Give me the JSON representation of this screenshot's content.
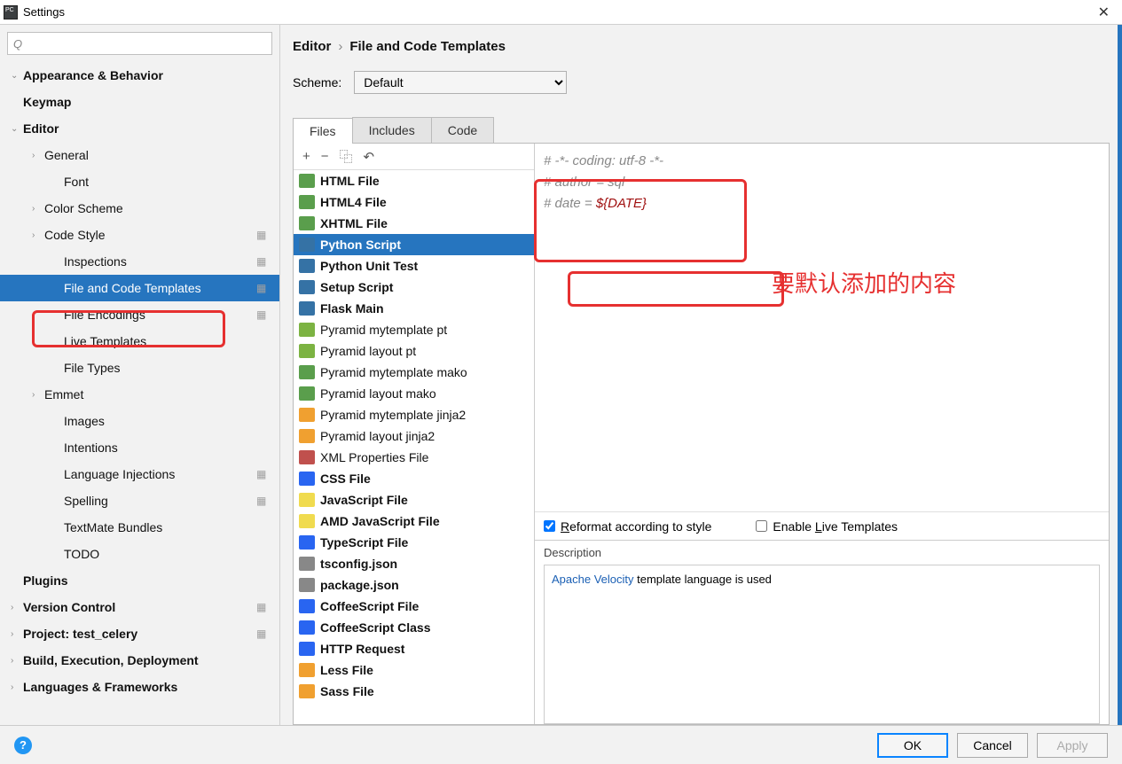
{
  "window": {
    "title": "Settings"
  },
  "search": {
    "placeholder": ""
  },
  "sidebar": {
    "items": [
      {
        "label": "Appearance & Behavior",
        "lvl": 0,
        "bold": true,
        "chev": "v"
      },
      {
        "label": "Keymap",
        "lvl": 0,
        "bold": true
      },
      {
        "label": "Editor",
        "lvl": 0,
        "bold": true,
        "chev": "v"
      },
      {
        "label": "General",
        "lvl": 1,
        "chev": ">"
      },
      {
        "label": "Font",
        "lvl": 2
      },
      {
        "label": "Color Scheme",
        "lvl": 1,
        "chev": ">"
      },
      {
        "label": "Code Style",
        "lvl": 1,
        "chev": ">",
        "gear": true
      },
      {
        "label": "Inspections",
        "lvl": 2,
        "gear": true
      },
      {
        "label": "File and Code Templates",
        "lvl": 2,
        "gear": true,
        "selected": true
      },
      {
        "label": "File Encodings",
        "lvl": 2,
        "gear": true
      },
      {
        "label": "Live Templates",
        "lvl": 2
      },
      {
        "label": "File Types",
        "lvl": 2
      },
      {
        "label": "Emmet",
        "lvl": 1,
        "chev": ">"
      },
      {
        "label": "Images",
        "lvl": 2
      },
      {
        "label": "Intentions",
        "lvl": 2
      },
      {
        "label": "Language Injections",
        "lvl": 2,
        "gear": true
      },
      {
        "label": "Spelling",
        "lvl": 2,
        "gear": true
      },
      {
        "label": "TextMate Bundles",
        "lvl": 2
      },
      {
        "label": "TODO",
        "lvl": 2
      },
      {
        "label": "Plugins",
        "lvl": 0,
        "bold": true
      },
      {
        "label": "Version Control",
        "lvl": 0,
        "bold": true,
        "chev": ">",
        "gear": true
      },
      {
        "label": "Project: test_celery",
        "lvl": 0,
        "bold": true,
        "chev": ">",
        "gear": true
      },
      {
        "label": "Build, Execution, Deployment",
        "lvl": 0,
        "bold": true,
        "chev": ">"
      },
      {
        "label": "Languages & Frameworks",
        "lvl": 0,
        "bold": true,
        "chev": ">"
      }
    ]
  },
  "breadcrumb": {
    "parent": "Editor",
    "current": "File and Code Templates"
  },
  "scheme": {
    "label": "Scheme:",
    "value": "Default"
  },
  "tabs": [
    "Files",
    "Includes",
    "Code"
  ],
  "active_tab": "Files",
  "toolbar": {
    "add": "+",
    "remove": "−",
    "copy": "⿻",
    "undo": "↶"
  },
  "templates": [
    {
      "label": "HTML File",
      "color": "#5a9e4c"
    },
    {
      "label": "HTML4 File",
      "color": "#5a9e4c"
    },
    {
      "label": "XHTML File",
      "color": "#5a9e4c"
    },
    {
      "label": "Python Script",
      "color": "#3572A5",
      "selected": true
    },
    {
      "label": "Python Unit Test",
      "color": "#3572A5"
    },
    {
      "label": "Setup Script",
      "color": "#3572A5"
    },
    {
      "label": "Flask Main",
      "color": "#3572A5"
    },
    {
      "label": "Pyramid mytemplate pt",
      "color": "#7cb342",
      "plain": true
    },
    {
      "label": "Pyramid layout pt",
      "color": "#7cb342",
      "plain": true
    },
    {
      "label": "Pyramid mytemplate mako",
      "color": "#5a9e4c",
      "plain": true
    },
    {
      "label": "Pyramid layout mako",
      "color": "#5a9e4c",
      "plain": true
    },
    {
      "label": "Pyramid mytemplate jinja2",
      "color": "#f0a030",
      "plain": true
    },
    {
      "label": "Pyramid layout jinja2",
      "color": "#f0a030",
      "plain": true
    },
    {
      "label": "XML Properties File",
      "color": "#c0504d",
      "plain": true
    },
    {
      "label": "CSS File",
      "color": "#2965f1"
    },
    {
      "label": "JavaScript File",
      "color": "#f0db4f"
    },
    {
      "label": "AMD JavaScript File",
      "color": "#f0db4f"
    },
    {
      "label": "TypeScript File",
      "color": "#2965f1"
    },
    {
      "label": "tsconfig.json",
      "color": "#888"
    },
    {
      "label": "package.json",
      "color": "#888"
    },
    {
      "label": "CoffeeScript File",
      "color": "#2965f1"
    },
    {
      "label": "CoffeeScript Class",
      "color": "#2965f1"
    },
    {
      "label": "HTTP Request",
      "color": "#2965f1"
    },
    {
      "label": "Less File",
      "color": "#f0a030"
    },
    {
      "label": "Sass File",
      "color": "#f0a030"
    }
  ],
  "code": {
    "line1": "# -*- coding: utf-8 -*-",
    "line2": "# author = sql",
    "line3_prefix": "# date = ",
    "line3_var": "${DATE}"
  },
  "options": {
    "reformat": "Reformat according to style",
    "live": "Enable Live Templates"
  },
  "description": {
    "label": "Description",
    "link": "Apache Velocity",
    "rest": " template language is used"
  },
  "annotation": "要默认添加的内容",
  "footer": {
    "ok": "OK",
    "cancel": "Cancel",
    "apply": "Apply"
  }
}
